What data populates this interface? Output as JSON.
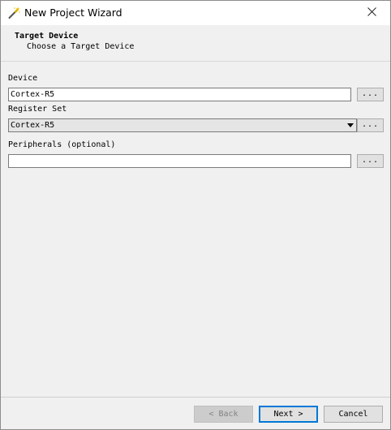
{
  "window": {
    "title": "New Project Wizard",
    "close_glyph": "✕"
  },
  "header": {
    "title": "Target Device",
    "subtitle": "Choose a Target Device"
  },
  "fields": {
    "device": {
      "label": "Device",
      "value": "Cortex-R5",
      "browse_label": "..."
    },
    "register_set": {
      "label": "Register Set",
      "value": "Cortex-R5",
      "browse_label": "..."
    },
    "peripherals": {
      "label": "Peripherals (optional)",
      "value": "",
      "browse_label": "..."
    }
  },
  "footer": {
    "back_label": "< Back",
    "next_label": "Next >",
    "cancel_label": "Cancel"
  },
  "icons": {
    "title": "wizard-wand-icon",
    "close": "close-icon",
    "dropdown": "chevron-down-icon"
  },
  "colors": {
    "accent": "#0078d7",
    "window_bg": "#f0f0f0",
    "title_bg": "#ffffff"
  }
}
